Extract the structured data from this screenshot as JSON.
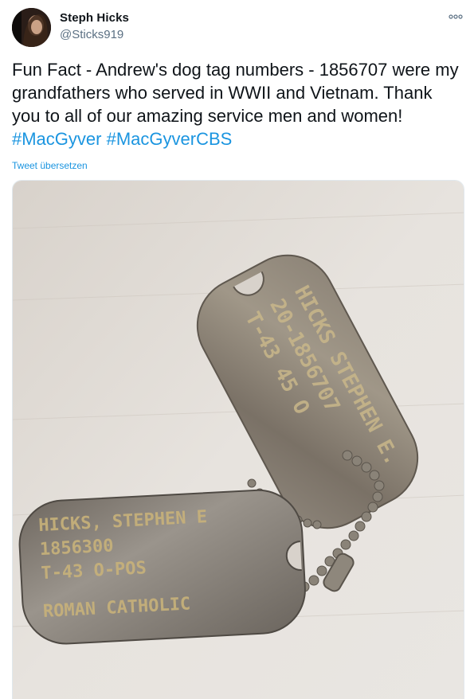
{
  "author": {
    "name": "Steph Hicks",
    "handle": "@Sticks919",
    "avatar_icon": "profile-photo"
  },
  "menu": {
    "icon": "more-options-icon"
  },
  "tweet": {
    "text_plain": "Fun Fact - Andrew's dog tag numbers - 1856707 were my grandfathers who served in WWII and Vietnam. Thank you to all of our amazing service men and women! ",
    "hashtags": [
      "#MacGyver",
      "#MacGyverCBS"
    ],
    "translate_label": "Tweet übersetzen"
  },
  "media": {
    "description_icon": "dog-tags-photo",
    "tag_top_lines": [
      "HICKS",
      "STEPHEN E.",
      "20-1856707",
      "T-43 45 O"
    ],
    "tag_bottom_lines": [
      "HICKS, STEPHEN E",
      "1856300",
      "T-43 O-POS",
      "ROMAN CATHOLIC"
    ]
  },
  "colors": {
    "link": "#1b95e0",
    "secondary": "#5b7083",
    "text": "#0f1419"
  }
}
